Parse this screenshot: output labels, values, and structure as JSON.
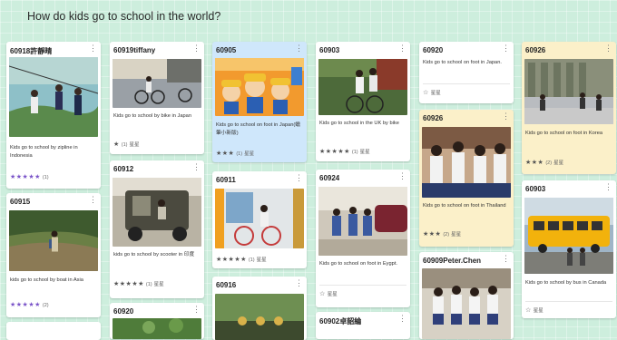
{
  "board": {
    "title": "How do kids go to school in the world?"
  },
  "columns": [
    {
      "cards": [
        {
          "author": "60918許靜晴",
          "caption": "Kids go to school by zipline in Indonesia",
          "stars": "★★★★★",
          "count": "(1)",
          "label": ""
        },
        {
          "author": "60915",
          "caption": "kids go to school by boat in Asia",
          "stars": "★★★★★",
          "count": "(2)",
          "label": ""
        },
        {
          "author": "",
          "caption": "",
          "stars": "",
          "count": "",
          "label": ""
        }
      ]
    },
    {
      "cards": [
        {
          "author": "60919tiffany",
          "caption": "Kids go to school by bike in Japan",
          "stars": "★",
          "count": "(1)",
          "label": "星星"
        },
        {
          "author": "60912",
          "caption": "kids go to school by scooter in 印度",
          "stars": "★★★★★",
          "count": "(1)",
          "label": "星星"
        },
        {
          "author": "60920",
          "caption": "",
          "stars": "",
          "count": "",
          "label": ""
        }
      ]
    },
    {
      "cards": [
        {
          "author": "60905",
          "caption": "Kids go to school on foot in Japan(蠟筆小新版)",
          "stars": "★★★",
          "count": "(1)",
          "label": "星星"
        },
        {
          "author": "60911",
          "caption": "",
          "stars": "★★★★★",
          "count": "(1)",
          "label": "星星"
        },
        {
          "author": "60916",
          "caption": "",
          "stars": "",
          "count": "",
          "label": ""
        }
      ]
    },
    {
      "cards": [
        {
          "author": "60903",
          "caption": "Kids go to school in the UK by bike",
          "stars": "★★★★★",
          "count": "(1)",
          "label": "星星"
        },
        {
          "author": "60924",
          "caption": "Kids go to school on foot in Eygpt.",
          "stars": "☆",
          "count": "",
          "label": "星星"
        },
        {
          "author": "60902卓韶綸",
          "caption": "",
          "stars": "",
          "count": "",
          "label": ""
        }
      ]
    },
    {
      "cards": [
        {
          "author": "60920",
          "caption": "Kids go to school on foot in Japan.",
          "stars": "☆",
          "count": "",
          "label": "星星"
        },
        {
          "author": "60926",
          "caption": "Kids go to school on foot in Thailand",
          "stars": "★★★",
          "count": "(2)",
          "label": "星星"
        },
        {
          "author": "60909Peter.Chen",
          "caption": "",
          "stars": "",
          "count": "",
          "label": ""
        }
      ]
    },
    {
      "cards": [
        {
          "author": "60926",
          "caption": "Kids go to school on foot in Korea",
          "stars": "★★★",
          "count": "(2)",
          "label": "星星"
        },
        {
          "author": "60903",
          "caption": "Kids go to school by bus in Canada",
          "stars": "☆",
          "count": "",
          "label": "星星"
        }
      ]
    }
  ],
  "colors": {
    "background": "#cdeedd",
    "star_purple": "#7b55c9",
    "card_blue": "#cfe7fb",
    "card_yellow": "#fbf0c9"
  },
  "icons": {
    "more": "more-vertical-icon",
    "star": "star-icon"
  }
}
